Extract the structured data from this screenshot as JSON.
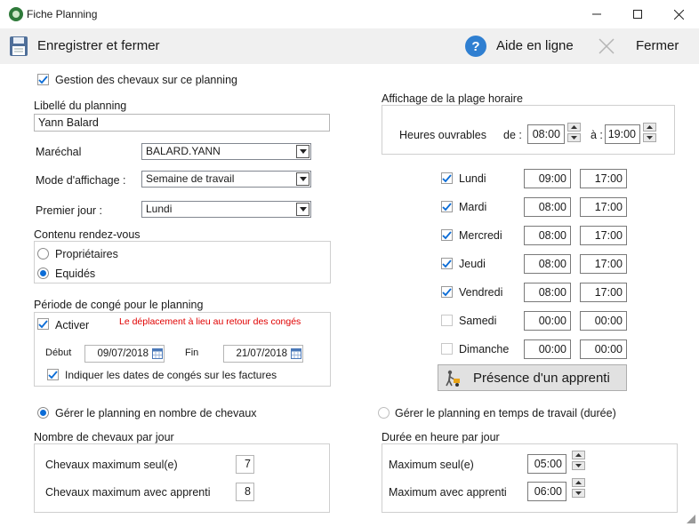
{
  "window": {
    "title": "Fiche Planning"
  },
  "toolbar": {
    "save_label": "Enregistrer et fermer",
    "help_label": "Aide en ligne",
    "close_label": "Fermer"
  },
  "gestion_chevaux": {
    "label": "Gestion des chevaux sur ce planning",
    "checked": true
  },
  "libelle": {
    "label": "Libellé du planning",
    "value": "Yann Balard"
  },
  "marechal": {
    "label": "Maréchal",
    "value": "BALARD.YANN"
  },
  "mode": {
    "label": "Mode d'affichage :",
    "value": "Semaine de travail"
  },
  "premier_jour": {
    "label": "Premier jour :",
    "value": "Lundi"
  },
  "contenu": {
    "title": "Contenu rendez-vous",
    "options": [
      "Propriétaires",
      "Equidés"
    ],
    "selected": "Equidés"
  },
  "conge": {
    "title": "Période de congé pour le planning",
    "activer_label": "Activer",
    "warning": "Le déplacement à lieu au retour des congés",
    "debut_label": "Début",
    "debut_value": "09/07/2018",
    "fin_label": "Fin",
    "fin_value": "21/07/2018",
    "indiquer_label": "Indiquer les dates de congés sur les factures"
  },
  "plage": {
    "title": "Affichage de la plage horaire",
    "heures_label": "Heures ouvrables",
    "de_label": "de :",
    "de_value": "08:00",
    "a_label": "à :",
    "a_value": "19:00"
  },
  "days": [
    {
      "name": "Lundi",
      "checked": true,
      "start": "09:00",
      "end": "17:00"
    },
    {
      "name": "Mardi",
      "checked": true,
      "start": "08:00",
      "end": "17:00"
    },
    {
      "name": "Mercredi",
      "checked": true,
      "start": "08:00",
      "end": "17:00"
    },
    {
      "name": "Jeudi",
      "checked": true,
      "start": "08:00",
      "end": "17:00"
    },
    {
      "name": "Vendredi",
      "checked": true,
      "start": "08:00",
      "end": "17:00"
    },
    {
      "name": "Samedi",
      "checked": false,
      "start": "00:00",
      "end": "00:00"
    },
    {
      "name": "Dimanche",
      "checked": false,
      "start": "00:00",
      "end": "00:00"
    }
  ],
  "apprenti_button": "Présence d'un apprenti",
  "gerer": {
    "chevaux_label": "Gérer le planning en nombre de chevaux",
    "temps_label": "Gérer le planning en temps de travail (durée)",
    "selected": "chevaux"
  },
  "nb_chevaux": {
    "title": "Nombre de chevaux par jour",
    "seul_label": "Chevaux maximum seul(e)",
    "seul_value": "7",
    "apprenti_label": "Chevaux maximum avec apprenti",
    "apprenti_value": "8"
  },
  "duree": {
    "title": "Durée en heure par jour",
    "seul_label": "Maximum seul(e)",
    "seul_value": "05:00",
    "apprenti_label": "Maximum avec apprenti",
    "apprenti_value": "06:00"
  },
  "colors": {
    "accent": "#0b6cd6",
    "warning": "#e00000",
    "toolbar_bg": "#f0f0f0"
  }
}
